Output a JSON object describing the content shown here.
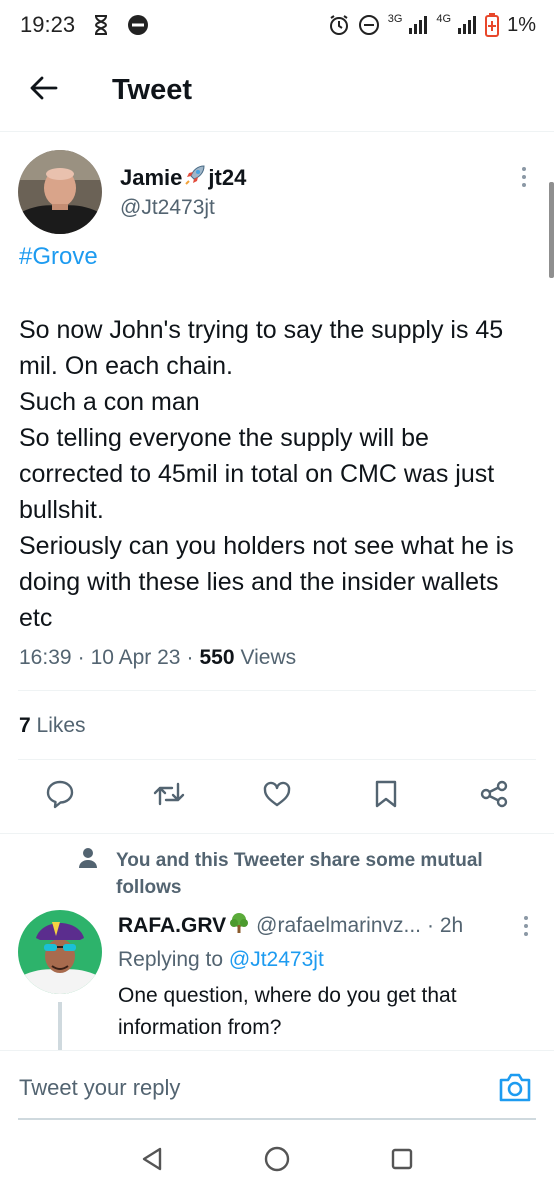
{
  "status_bar": {
    "time": "19:23",
    "network_a": "3G",
    "network_b": "4G",
    "battery": "1%"
  },
  "header": {
    "title": "Tweet"
  },
  "tweet": {
    "display_name": "Jamie",
    "display_name_suffix": "jt24",
    "handle": "@Jt2473jt",
    "hashtag": "#Grove",
    "text": "So now John's trying to say the supply is 45 mil. On each chain.\nSuch a con man\nSo telling everyone the supply will be corrected to 45mil in total on CMC was just bullshit.\nSeriously can you holders not see what he is doing with these lies and the insider wallets etc",
    "time": "16:39",
    "date": "10 Apr 23",
    "separator": "·",
    "views_count": "550",
    "views_label": "Views",
    "likes_count": "7",
    "likes_label": "Likes"
  },
  "social_context": {
    "text": "You and this Tweeter share some mutual follows"
  },
  "reply": {
    "name": "RAFA.GRV",
    "handle": "@rafaelmarinvz...",
    "time": "· 2h",
    "replying_prefix": "Replying to",
    "replying_to": "@Jt2473jt",
    "text": "One question, where do you get that information from?"
  },
  "composer": {
    "placeholder": "Tweet your reply"
  },
  "colors": {
    "accent": "#1d9bf0",
    "text_primary": "#0f1419",
    "text_secondary": "#536471",
    "battery_low": "#e8472b"
  },
  "icons": {
    "status": [
      "alarm-icon",
      "dnd-icon",
      "signal-icon",
      "battery-icon",
      "hourglass-icon",
      "blocked-icon"
    ],
    "actions": [
      "reply-icon",
      "retweet-icon",
      "like-icon",
      "bookmark-icon",
      "share-icon"
    ],
    "nav": [
      "back-triangle-icon",
      "home-circle-icon",
      "recents-square-icon"
    ]
  }
}
